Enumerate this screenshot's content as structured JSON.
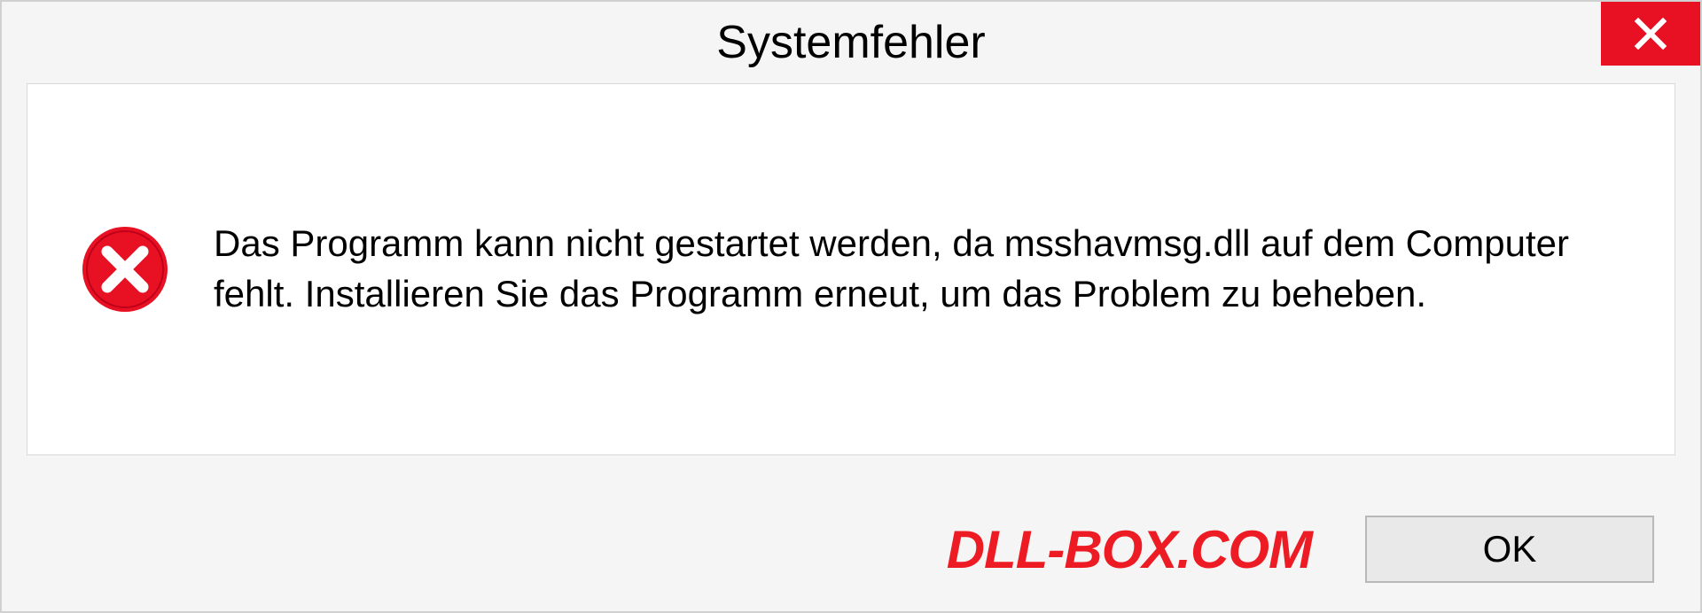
{
  "dialog": {
    "title": "Systemfehler",
    "message": "Das Programm kann nicht gestartet werden, da msshavmsg.dll auf dem Computer fehlt. Installieren Sie das Programm erneut, um das Problem zu beheben.",
    "watermark": "DLL-BOX.COM",
    "ok_label": "OK"
  },
  "colors": {
    "close_button": "#e81123",
    "error_icon": "#e81123",
    "watermark": "#ed1c24"
  }
}
